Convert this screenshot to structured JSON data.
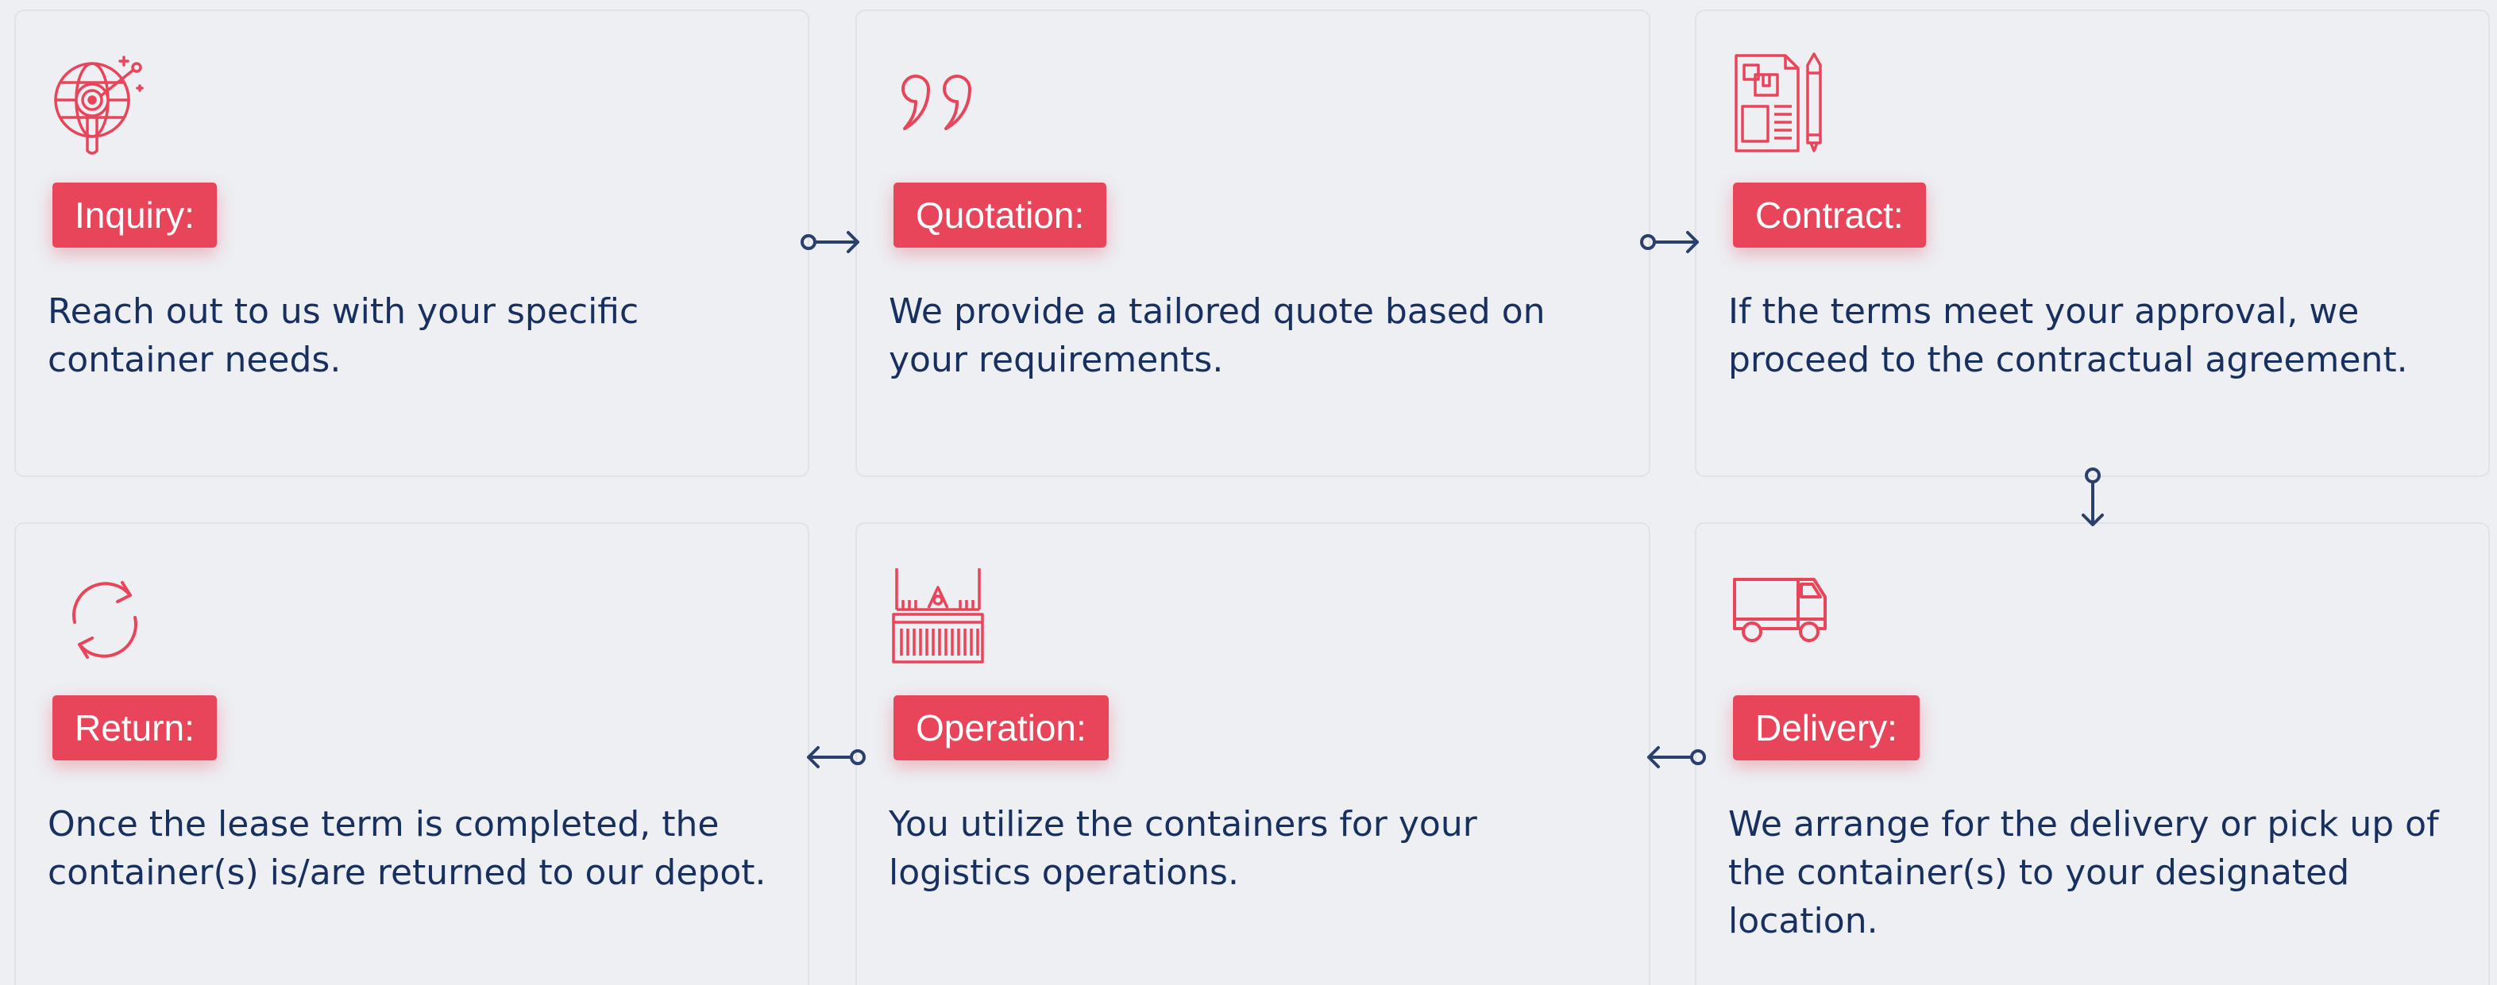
{
  "colors": {
    "background": "#edeff3",
    "card_border": "#dfe2e8",
    "accent": "#e8455a",
    "text": "#17305f",
    "arrow": "#2a3f6b"
  },
  "steps": [
    {
      "icon": "globe-target-icon",
      "label": "Inquiry:",
      "description": "Reach out to us with your specific container needs."
    },
    {
      "icon": "quote-marks-icon",
      "label": "Quotation:",
      "description": "We provide a tailored quote based on your requirements."
    },
    {
      "icon": "contract-document-icon",
      "label": "Contract:",
      "description": "If the terms meet your approval, we proceed to the contractual agreement."
    },
    {
      "icon": "delivery-truck-icon",
      "label": "Delivery:",
      "description": "We arrange for the delivery or pick up of the container(s) to your designated location."
    },
    {
      "icon": "shipping-container-icon",
      "label": "Operation:",
      "description": "You utilize the containers for your logistics operations."
    },
    {
      "icon": "refresh-cycle-icon",
      "label": "Return:",
      "description": "Once the lease term is completed, the container(s) is/are returned to our depot."
    }
  ]
}
